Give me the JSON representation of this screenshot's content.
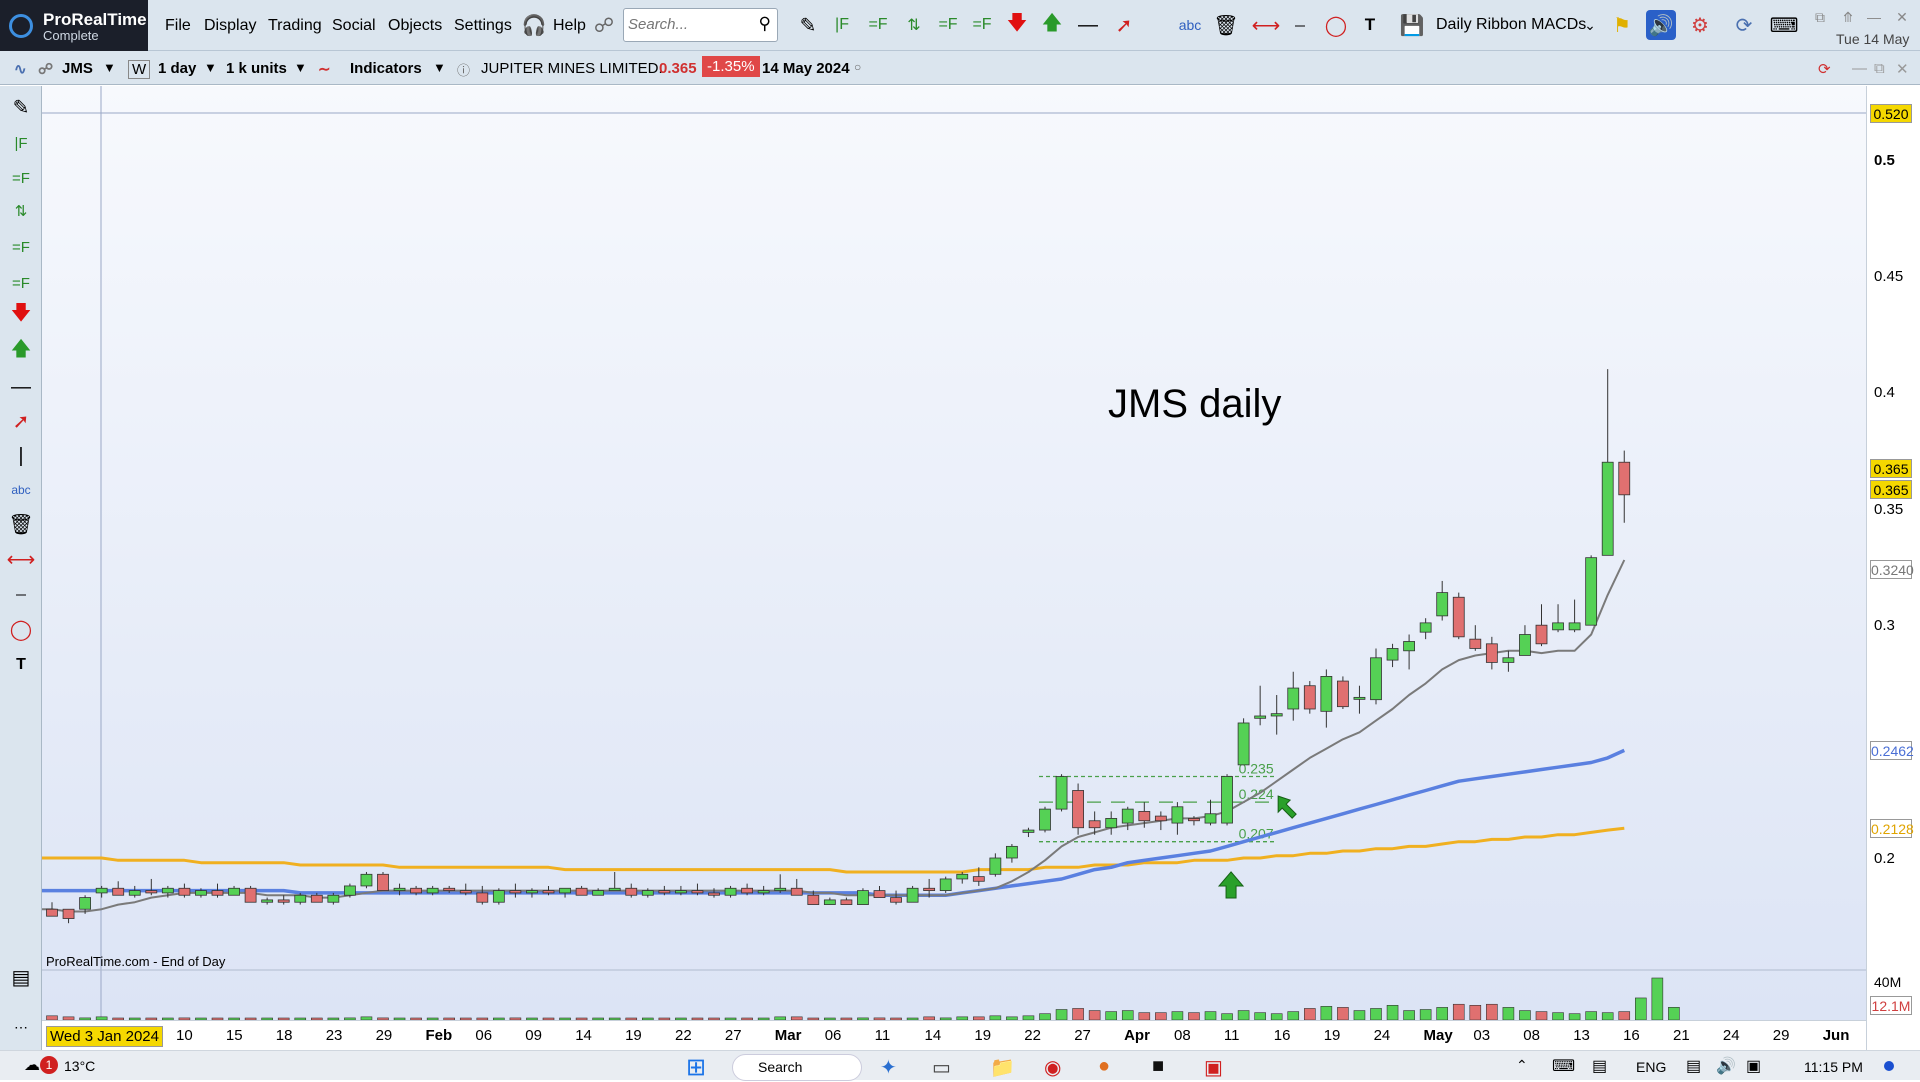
{
  "app": {
    "name": "ProRealTime",
    "edition": "Complete",
    "date": "Tue 14 May"
  },
  "menu": [
    "File",
    "Display",
    "Trading",
    "Social",
    "Objects",
    "Settings",
    "Help"
  ],
  "search": {
    "placeholder": "Search..."
  },
  "toolbar": {
    "list_name": "Daily Ribbon MACDs"
  },
  "instrument_bar": {
    "ticker": "JMS",
    "w_button": "W",
    "timeframe": "1 day",
    "units": "1 k units",
    "indicators": "Indicators",
    "name": "JUPITER MINES LIMITED.",
    "price": "0.365",
    "change": "-1.35%",
    "date": "14 May 2024"
  },
  "chart_data": {
    "type": "candlestick",
    "title": "JMS daily",
    "source_note": "ProRealTime.com - End of Day",
    "y_range": [
      0.155,
      0.53
    ],
    "y_ticks": [
      "0.5",
      "0.45",
      "0.4",
      "0.35",
      "0.3",
      "0.2"
    ],
    "price_tags": [
      {
        "label": "0.520",
        "value": 0.52,
        "bg": "#f5d800"
      },
      {
        "label": "0.365",
        "value": 0.3675,
        "bg": "#f5d800"
      },
      {
        "label": "0.365",
        "value": 0.3585,
        "bg": "#f5d800"
      },
      {
        "label": "0.3240",
        "value": 0.324,
        "bg": "#ffffff",
        "color": "#777777"
      },
      {
        "label": "0.2462",
        "value": 0.2462,
        "bg": "#ffffff",
        "color": "#4a6fd6"
      },
      {
        "label": "0.2128",
        "value": 0.2128,
        "bg": "#ffffff",
        "color": "#e0a400"
      }
    ],
    "horizontal_levels": [
      {
        "label": "0.235",
        "value": 0.235
      },
      {
        "label": "0.224",
        "value": 0.224
      },
      {
        "label": "0.207",
        "value": 0.207
      }
    ],
    "cursor_date_label": "Wed 3 Jan 2024",
    "date_labels": [
      "10",
      "15",
      "18",
      "23",
      "29",
      "Feb",
      "06",
      "09",
      "14",
      "19",
      "22",
      "27",
      "Mar",
      "06",
      "11",
      "14",
      "19",
      "22",
      "27",
      "Apr",
      "08",
      "11",
      "16",
      "19",
      "24",
      "May",
      "03",
      "08",
      "13",
      "16",
      "21",
      "24",
      "29",
      "Jun"
    ],
    "volume_labels": [
      "40M",
      "12.1M"
    ],
    "candles": [
      [
        0.178,
        0.181,
        0.175,
        0.175
      ],
      [
        0.178,
        0.178,
        0.172,
        0.174
      ],
      [
        0.178,
        0.184,
        0.176,
        0.183
      ],
      [
        0.185,
        0.188,
        0.183,
        0.187
      ],
      [
        0.187,
        0.19,
        0.184,
        0.184
      ],
      [
        0.184,
        0.188,
        0.183,
        0.186
      ],
      [
        0.186,
        0.191,
        0.184,
        0.185
      ],
      [
        0.185,
        0.188,
        0.183,
        0.187
      ],
      [
        0.187,
        0.189,
        0.183,
        0.184
      ],
      [
        0.184,
        0.187,
        0.183,
        0.186
      ],
      [
        0.186,
        0.189,
        0.183,
        0.184
      ],
      [
        0.184,
        0.188,
        0.184,
        0.187
      ],
      [
        0.187,
        0.188,
        0.181,
        0.181
      ],
      [
        0.181,
        0.183,
        0.18,
        0.182
      ],
      [
        0.182,
        0.184,
        0.18,
        0.181
      ],
      [
        0.181,
        0.185,
        0.18,
        0.184
      ],
      [
        0.184,
        0.185,
        0.181,
        0.181
      ],
      [
        0.181,
        0.185,
        0.18,
        0.184
      ],
      [
        0.184,
        0.189,
        0.183,
        0.188
      ],
      [
        0.188,
        0.194,
        0.187,
        0.193
      ],
      [
        0.193,
        0.194,
        0.186,
        0.186
      ],
      [
        0.186,
        0.189,
        0.184,
        0.187
      ],
      [
        0.187,
        0.188,
        0.184,
        0.185
      ],
      [
        0.185,
        0.188,
        0.184,
        0.187
      ],
      [
        0.187,
        0.188,
        0.185,
        0.186
      ],
      [
        0.186,
        0.189,
        0.184,
        0.185
      ],
      [
        0.185,
        0.188,
        0.18,
        0.181
      ],
      [
        0.181,
        0.187,
        0.18,
        0.186
      ],
      [
        0.186,
        0.189,
        0.183,
        0.185
      ],
      [
        0.185,
        0.187,
        0.183,
        0.186
      ],
      [
        0.186,
        0.188,
        0.184,
        0.185
      ],
      [
        0.185,
        0.187,
        0.183,
        0.187
      ],
      [
        0.187,
        0.188,
        0.184,
        0.184
      ],
      [
        0.184,
        0.187,
        0.184,
        0.186
      ],
      [
        0.186,
        0.194,
        0.186,
        0.187
      ],
      [
        0.187,
        0.189,
        0.183,
        0.184
      ],
      [
        0.184,
        0.187,
        0.183,
        0.186
      ],
      [
        0.186,
        0.188,
        0.184,
        0.185
      ],
      [
        0.185,
        0.188,
        0.184,
        0.186
      ],
      [
        0.186,
        0.189,
        0.184,
        0.185
      ],
      [
        0.185,
        0.187,
        0.183,
        0.184
      ],
      [
        0.184,
        0.188,
        0.183,
        0.187
      ],
      [
        0.187,
        0.189,
        0.184,
        0.185
      ],
      [
        0.185,
        0.188,
        0.184,
        0.186
      ],
      [
        0.186,
        0.193,
        0.185,
        0.187
      ],
      [
        0.187,
        0.191,
        0.184,
        0.184
      ],
      [
        0.184,
        0.186,
        0.18,
        0.18
      ],
      [
        0.18,
        0.183,
        0.18,
        0.182
      ],
      [
        0.182,
        0.183,
        0.18,
        0.18
      ],
      [
        0.18,
        0.187,
        0.18,
        0.186
      ],
      [
        0.186,
        0.188,
        0.183,
        0.183
      ],
      [
        0.183,
        0.186,
        0.18,
        0.181
      ],
      [
        0.181,
        0.188,
        0.181,
        0.187
      ],
      [
        0.187,
        0.191,
        0.183,
        0.186
      ],
      [
        0.186,
        0.192,
        0.185,
        0.191
      ],
      [
        0.191,
        0.194,
        0.189,
        0.193
      ],
      [
        0.192,
        0.196,
        0.188,
        0.19
      ],
      [
        0.193,
        0.202,
        0.192,
        0.2
      ],
      [
        0.2,
        0.206,
        0.198,
        0.205
      ],
      [
        0.211,
        0.213,
        0.209,
        0.212
      ],
      [
        0.212,
        0.222,
        0.211,
        0.221
      ],
      [
        0.221,
        0.236,
        0.22,
        0.235
      ],
      [
        0.229,
        0.232,
        0.21,
        0.213
      ],
      [
        0.216,
        0.22,
        0.21,
        0.213
      ],
      [
        0.213,
        0.22,
        0.21,
        0.217
      ],
      [
        0.215,
        0.222,
        0.212,
        0.221
      ],
      [
        0.22,
        0.224,
        0.213,
        0.216
      ],
      [
        0.218,
        0.22,
        0.212,
        0.216
      ],
      [
        0.215,
        0.224,
        0.21,
        0.222
      ],
      [
        0.217,
        0.218,
        0.214,
        0.216
      ],
      [
        0.215,
        0.225,
        0.214,
        0.219
      ],
      [
        0.215,
        0.236,
        0.214,
        0.235
      ],
      [
        0.24,
        0.26,
        0.24,
        0.258
      ],
      [
        0.26,
        0.274,
        0.257,
        0.261
      ],
      [
        0.261,
        0.27,
        0.253,
        0.262
      ],
      [
        0.264,
        0.28,
        0.259,
        0.273
      ],
      [
        0.274,
        0.276,
        0.262,
        0.264
      ],
      [
        0.263,
        0.281,
        0.256,
        0.278
      ],
      [
        0.276,
        0.278,
        0.264,
        0.265
      ],
      [
        0.269,
        0.274,
        0.262,
        0.269
      ],
      [
        0.268,
        0.29,
        0.266,
        0.286
      ],
      [
        0.285,
        0.292,
        0.282,
        0.29
      ],
      [
        0.289,
        0.296,
        0.281,
        0.293
      ],
      [
        0.297,
        0.303,
        0.294,
        0.301
      ],
      [
        0.304,
        0.319,
        0.302,
        0.314
      ],
      [
        0.312,
        0.314,
        0.294,
        0.295
      ],
      [
        0.294,
        0.3,
        0.289,
        0.29
      ],
      [
        0.292,
        0.295,
        0.281,
        0.284
      ],
      [
        0.284,
        0.289,
        0.28,
        0.286
      ],
      [
        0.287,
        0.3,
        0.287,
        0.296
      ],
      [
        0.3,
        0.309,
        0.291,
        0.292
      ],
      [
        0.298,
        0.309,
        0.297,
        0.301
      ],
      [
        0.298,
        0.311,
        0.297,
        0.301
      ],
      [
        0.3,
        0.33,
        0.3,
        0.329
      ],
      [
        0.33,
        0.41,
        0.33,
        0.37
      ],
      [
        0.37,
        0.375,
        0.344,
        0.356
      ]
    ],
    "sma_grey": [
      0.178,
      0.177,
      0.177,
      0.178,
      0.18,
      0.181,
      0.183,
      0.184,
      0.185,
      0.185,
      0.185,
      0.185,
      0.185,
      0.184,
      0.184,
      0.184,
      0.183,
      0.183,
      0.184,
      0.185,
      0.186,
      0.186,
      0.186,
      0.186,
      0.186,
      0.186,
      0.186,
      0.186,
      0.186,
      0.186,
      0.186,
      0.186,
      0.186,
      0.186,
      0.186,
      0.186,
      0.186,
      0.186,
      0.186,
      0.186,
      0.186,
      0.186,
      0.186,
      0.186,
      0.186,
      0.186,
      0.185,
      0.185,
      0.184,
      0.184,
      0.184,
      0.184,
      0.184,
      0.184,
      0.184,
      0.185,
      0.186,
      0.187,
      0.19,
      0.194,
      0.199,
      0.205,
      0.209,
      0.211,
      0.213,
      0.214,
      0.215,
      0.216,
      0.217,
      0.217,
      0.218,
      0.22,
      0.224,
      0.228,
      0.233,
      0.238,
      0.243,
      0.247,
      0.251,
      0.254,
      0.259,
      0.264,
      0.27,
      0.275,
      0.281,
      0.285,
      0.287,
      0.288,
      0.289,
      0.289,
      0.288,
      0.289,
      0.289,
      0.296,
      0.313,
      0.328
    ],
    "sma_blue": [
      0.186,
      0.186,
      0.186,
      0.186,
      0.186,
      0.186,
      0.186,
      0.186,
      0.186,
      0.186,
      0.186,
      0.186,
      0.186,
      0.186,
      0.186,
      0.185,
      0.185,
      0.185,
      0.185,
      0.185,
      0.185,
      0.185,
      0.185,
      0.185,
      0.185,
      0.185,
      0.185,
      0.185,
      0.185,
      0.185,
      0.185,
      0.185,
      0.185,
      0.185,
      0.185,
      0.185,
      0.185,
      0.185,
      0.185,
      0.185,
      0.185,
      0.185,
      0.185,
      0.185,
      0.185,
      0.185,
      0.185,
      0.185,
      0.185,
      0.185,
      0.184,
      0.184,
      0.184,
      0.184,
      0.184,
      0.185,
      0.186,
      0.187,
      0.188,
      0.189,
      0.19,
      0.191,
      0.193,
      0.195,
      0.196,
      0.198,
      0.199,
      0.2,
      0.201,
      0.202,
      0.203,
      0.205,
      0.207,
      0.209,
      0.211,
      0.213,
      0.215,
      0.217,
      0.219,
      0.221,
      0.223,
      0.225,
      0.227,
      0.229,
      0.231,
      0.233,
      0.234,
      0.235,
      0.236,
      0.237,
      0.238,
      0.239,
      0.24,
      0.241,
      0.243,
      0.2462
    ],
    "sma_orange": [
      0.2,
      0.2,
      0.2,
      0.2,
      0.199,
      0.199,
      0.199,
      0.199,
      0.199,
      0.198,
      0.198,
      0.198,
      0.198,
      0.198,
      0.198,
      0.197,
      0.197,
      0.197,
      0.197,
      0.197,
      0.197,
      0.196,
      0.196,
      0.196,
      0.196,
      0.196,
      0.196,
      0.196,
      0.196,
      0.196,
      0.196,
      0.195,
      0.195,
      0.195,
      0.195,
      0.195,
      0.195,
      0.195,
      0.195,
      0.195,
      0.195,
      0.195,
      0.195,
      0.195,
      0.195,
      0.195,
      0.195,
      0.195,
      0.194,
      0.194,
      0.194,
      0.194,
      0.194,
      0.194,
      0.194,
      0.194,
      0.195,
      0.195,
      0.195,
      0.195,
      0.196,
      0.196,
      0.196,
      0.197,
      0.197,
      0.197,
      0.198,
      0.198,
      0.198,
      0.199,
      0.199,
      0.199,
      0.2,
      0.2,
      0.201,
      0.201,
      0.202,
      0.202,
      0.203,
      0.203,
      0.204,
      0.204,
      0.205,
      0.205,
      0.206,
      0.207,
      0.207,
      0.208,
      0.208,
      0.209,
      0.209,
      0.21,
      0.21,
      0.211,
      0.212,
      0.2128
    ],
    "volume": [
      4,
      3,
      2,
      3,
      1,
      1,
      1,
      1,
      2,
      1,
      1,
      1,
      1,
      1,
      1,
      1,
      1,
      1,
      2,
      3,
      2,
      1,
      1,
      1,
      1,
      1,
      1,
      1,
      2,
      1,
      1,
      1,
      1,
      1,
      1,
      1,
      1,
      1,
      1,
      1,
      1,
      1,
      1,
      1,
      3,
      3,
      1,
      1,
      1,
      2,
      2,
      1,
      1,
      3,
      2,
      3,
      3,
      4,
      3,
      4,
      6,
      10,
      11,
      9,
      8,
      9,
      7,
      7,
      8,
      7,
      8,
      6,
      9,
      7,
      6,
      8,
      11,
      13,
      12,
      9,
      11,
      14,
      9,
      10,
      12,
      15,
      14,
      15,
      12,
      9,
      8,
      7,
      6,
      8,
      7,
      8,
      21,
      40,
      12.1
    ],
    "volume_max": 40
  },
  "colors": {
    "up": "#55d155",
    "down": "#e07070",
    "sma_grey": "#7a7a7a",
    "sma_blue": "#5a80e0",
    "sma_orange": "#f0b020",
    "level": "#4aa04a",
    "chart_bg_top": "#f6f8fc",
    "chart_bg_bottom": "#dfe6f6"
  },
  "taskbar": {
    "weather": "13°C",
    "badge": "1",
    "lang": "ENG",
    "time": "11:15 PM",
    "search": "Search"
  }
}
